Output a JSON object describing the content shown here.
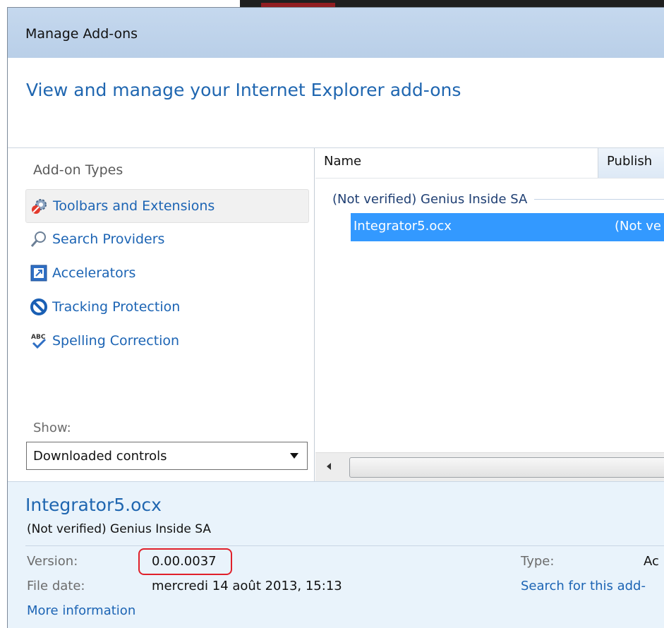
{
  "window": {
    "title": "Manage Add-ons"
  },
  "header": {
    "text": "View and manage your Internet Explorer add-ons"
  },
  "sidebar": {
    "heading": "Add-on Types",
    "items": [
      {
        "label": "Toolbars and Extensions",
        "icon": "gear-icon",
        "selected": true
      },
      {
        "label": "Search Providers",
        "icon": "search-icon",
        "selected": false
      },
      {
        "label": "Accelerators",
        "icon": "accelerator-icon",
        "selected": false
      },
      {
        "label": "Tracking Protection",
        "icon": "block-icon",
        "selected": false
      },
      {
        "label": "Spelling Correction",
        "icon": "spellcheck-icon",
        "selected": false
      }
    ],
    "show_label": "Show:",
    "show_value": "Downloaded controls"
  },
  "list": {
    "columns": [
      "Name",
      "Publish"
    ],
    "group": "(Not verified) Genius Inside SA",
    "rows": [
      {
        "name": "Integrator5.ocx",
        "publisher": "(Not ve",
        "selected": true
      }
    ]
  },
  "details": {
    "title": "Integrator5.ocx",
    "publisher": "(Not verified) Genius Inside SA",
    "version_label": "Version:",
    "version_value": "0.00.0037",
    "file_date_label": "File date:",
    "file_date_value": "mercredi 14 août 2013, 15:13",
    "more_info": "More information",
    "type_label": "Type:",
    "type_value": "Ac",
    "search_link": "Search for this add-"
  },
  "colors": {
    "accent": "#1f66b0",
    "selection": "#3399ff",
    "highlight_border": "#e0202a"
  }
}
